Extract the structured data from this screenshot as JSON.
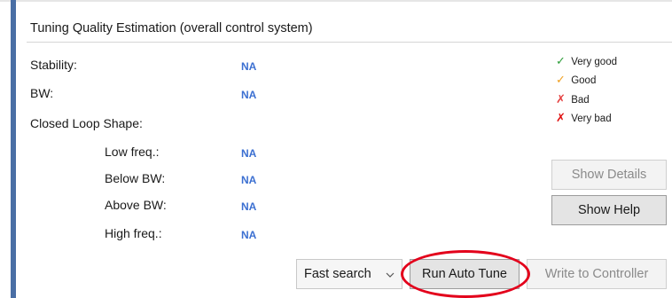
{
  "panel": {
    "title": "Tuning Quality Estimation (overall control system)"
  },
  "metrics": {
    "stability": {
      "label": "Stability:",
      "value": "NA"
    },
    "bw": {
      "label": "BW:",
      "value": "NA"
    },
    "closed_loop_shape": {
      "label": "Closed Loop Shape:"
    },
    "low_freq": {
      "label": "Low freq.:",
      "value": "NA"
    },
    "below_bw": {
      "label": "Below BW:",
      "value": "NA"
    },
    "above_bw": {
      "label": "Above BW:",
      "value": "NA"
    },
    "high_freq": {
      "label": "High freq.:",
      "value": "NA"
    }
  },
  "legend": {
    "very_good": {
      "symbol": "✓",
      "label": "Very good",
      "color": "#2e9e3a"
    },
    "good": {
      "symbol": "✓",
      "label": "Good",
      "color": "#f0a020"
    },
    "bad": {
      "symbol": "✗",
      "label": "Bad",
      "color": "#e54040"
    },
    "very_bad": {
      "symbol": "✗",
      "label": "Very bad",
      "color": "#e01010"
    }
  },
  "buttons": {
    "show_details": "Show Details",
    "show_help": "Show Help",
    "run_auto_tune": "Run Auto Tune",
    "write_to_controller": "Write to Controller"
  },
  "search_mode": {
    "selected": "Fast search"
  },
  "colors": {
    "value_blue": "#3b6fd1",
    "highlight_red": "#e3001b",
    "accent_bar": "#4a6fa5"
  }
}
